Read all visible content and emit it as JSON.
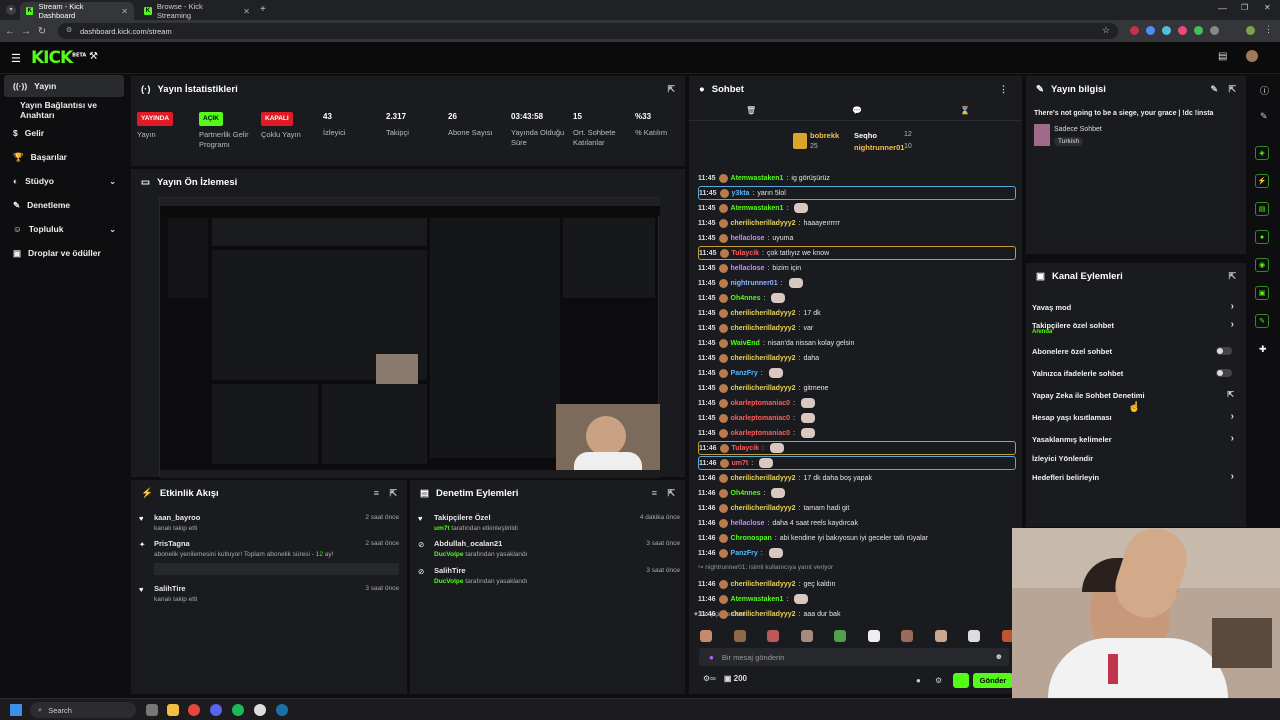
{
  "browser": {
    "tabs": [
      {
        "title": "Stream - Kick Dashboard"
      },
      {
        "title": "Browse - Kick Streaming"
      }
    ],
    "url": "dashboard.kick.com/stream"
  },
  "header": {
    "logo": "KICK",
    "logo_sup": "BETA"
  },
  "sidebar": {
    "items": [
      {
        "label": "Yayın",
        "icon": "broadcast-icon"
      },
      {
        "label": "Yayın Bağlantısı ve Anahtarı",
        "icon": ""
      },
      {
        "label": "Gelir",
        "icon": "dollar-icon"
      },
      {
        "label": "Başarılar",
        "icon": "trophy-icon"
      },
      {
        "label": "Stüdyo",
        "icon": "palette-icon"
      },
      {
        "label": "Denetleme",
        "icon": "wrench-icon"
      },
      {
        "label": "Topluluk",
        "icon": "people-icon"
      },
      {
        "label": "Droplar ve ödüller",
        "icon": "gift-icon"
      }
    ]
  },
  "stats": {
    "title": "Yayın İstatistikleri",
    "items": [
      {
        "badge": "YAYINDA",
        "label": "Yayın"
      },
      {
        "badge": "AÇIK",
        "label": "Partnerlik Gelir Programı"
      },
      {
        "badge": "KAPALI",
        "label": "Çoklu Yayın"
      },
      {
        "value": "43",
        "label": "İzleyici"
      },
      {
        "value": "2.317",
        "label": "Takipçi"
      },
      {
        "value": "26",
        "label": "Abone Sayısı"
      },
      {
        "value": "03:43:58",
        "label": "Yayında Olduğu Süre"
      },
      {
        "value": "15",
        "label": "Ort. Sohbete Katılanlar"
      },
      {
        "value": "%33",
        "label": "% Katılım"
      }
    ]
  },
  "preview": {
    "title": "Yayın Ön İzlemesi"
  },
  "activity": {
    "title": "Etkinlik Akışı",
    "items": [
      {
        "name": "kaan_bayroo",
        "desc": "kanalı takip etti",
        "time": "2 saat önce"
      },
      {
        "name": "PrisTagna",
        "desc": "abonelik yenilemesini kutluyor! Toplam abonelik süresi - ",
        "months": "12",
        "desc2": " ay!",
        "time": "2 saat önce"
      },
      {
        "name": "SalihTire",
        "desc": "kanalı takip etti",
        "time": "3 saat önce"
      }
    ]
  },
  "modactions": {
    "title": "Denetim Eylemleri",
    "items": [
      {
        "title": "Takipçilere Özel",
        "actor": "um7t",
        "desc": " tarafından etkinleştirildi",
        "time": "4 dakika önce"
      },
      {
        "title": "Abdullah_ocalan21",
        "actor": "DucVolpe",
        "desc": " tarafından yasaklandı",
        "time": "3 saat önce"
      },
      {
        "title": "SalihTire",
        "actor": "DucVolpe",
        "desc": " tarafından yasaklandı",
        "time": "3 saat önce"
      }
    ]
  },
  "chat": {
    "title": "Sohbet",
    "leaderboard": [
      {
        "name": "bobrekk",
        "count": "25"
      },
      {
        "name": "Seqho",
        "count": "12"
      },
      {
        "name": "nightrunner01",
        "count": "10"
      }
    ],
    "messages": [
      {
        "time": "11:45",
        "user": "Atemwastaken1",
        "color": "#53fc18",
        "text": "ig görüşürüz"
      },
      {
        "time": "11:45",
        "user": "y3kta",
        "color": "#57b7ff",
        "text": "yarın 5lol",
        "hl": "blue"
      },
      {
        "time": "11:45",
        "user": "Atemwastaken1",
        "color": "#53fc18",
        "text": ""
      },
      {
        "time": "11:45",
        "user": "cherilicherilladyyy2",
        "color": "#e6d25a",
        "text": "haaayeırrrrr"
      },
      {
        "time": "11:45",
        "user": "hellaclose",
        "color": "#c48cff",
        "text": "uyuma"
      },
      {
        "time": "11:45",
        "user": "Tulaycik",
        "color": "#ff5b5b",
        "text": "çok tatlıyız we know",
        "hl": "gold"
      },
      {
        "time": "11:45",
        "user": "hellaclose",
        "color": "#c48cff",
        "text": "bizim için"
      },
      {
        "time": "11:45",
        "user": "nightrunner01",
        "color": "#8fb4ff",
        "text": ""
      },
      {
        "time": "11:45",
        "user": "Oh4nnes",
        "color": "#53fc18",
        "text": ""
      },
      {
        "time": "11:45",
        "user": "cherilicherilladyyy2",
        "color": "#e6d25a",
        "text": "17 dk"
      },
      {
        "time": "11:45",
        "user": "cherilicherilladyyy2",
        "color": "#e6d25a",
        "text": "var"
      },
      {
        "time": "11:45",
        "user": "WaivEnd",
        "color": "#53fc18",
        "text": "nisan'da nissan kolay gelsin"
      },
      {
        "time": "11:45",
        "user": "cherilicherilladyyy2",
        "color": "#e6d25a",
        "text": "daha"
      },
      {
        "time": "11:45",
        "user": "PanzFry",
        "color": "#57b7ff",
        "text": ""
      },
      {
        "time": "11:45",
        "user": "cherilicherilladyyy2",
        "color": "#e6d25a",
        "text": "gitmene"
      },
      {
        "time": "11:45",
        "user": "okarleptomaniac0",
        "color": "#ff5b5b",
        "text": ""
      },
      {
        "time": "11:45",
        "user": "okarleptomaniac0",
        "color": "#ff5b5b",
        "text": ""
      },
      {
        "time": "11:45",
        "user": "okarleptomaniac0",
        "color": "#ff5b5b",
        "text": ""
      },
      {
        "time": "11:46",
        "user": "Tulaycik",
        "color": "#ff5b5b",
        "text": "",
        "hl": "gold"
      },
      {
        "time": "11:46",
        "user": "um7t",
        "color": "#ff5b5b",
        "text": "",
        "hl": "blue"
      },
      {
        "time": "11:46",
        "user": "cherilicherilladyyy2",
        "color": "#e6d25a",
        "text": "17 dk daha boş yapak"
      },
      {
        "time": "11:46",
        "user": "Oh4nnes",
        "color": "#53fc18",
        "text": ""
      },
      {
        "time": "11:46",
        "user": "cherilicherilladyyy2",
        "color": "#e6d25a",
        "text": "tamam hadi git"
      },
      {
        "time": "11:46",
        "user": "hellaclose",
        "color": "#c48cff",
        "text": "daha 4 saat reels kaydırcak"
      },
      {
        "time": "11:46",
        "user": "Chronospan",
        "color": "#53fc18",
        "text": "abi kendine iyi bakıyosun iyi geceler tatlı rüyalar"
      },
      {
        "time": "11:46",
        "user": "PanzFry",
        "color": "#57b7ff",
        "text": ""
      },
      {
        "time": "11:46",
        "user": "cherilicherilladyyy2",
        "color": "#e6d25a",
        "text": "geç kaldın"
      },
      {
        "time": "11:46",
        "user": "Atemwastaken1",
        "color": "#53fc18",
        "text": ""
      },
      {
        "time": "11:46",
        "user": "cherilicherilladyyy2",
        "color": "#e6d25a",
        "text": "aaa dur bak"
      }
    ],
    "reply_note": "nightrunner01:",
    "reply_note2": "isimli kullanıcıya yanıt veriyor",
    "followers_only": "Takipçilere Özel",
    "input_placeholder": "Bir mesaj gönderin",
    "points": "200",
    "send_label": "Gönder"
  },
  "streaminfo": {
    "title": "Yayın bilgisi",
    "stream_title": "There's not going to be a siege, your grace | !dc !insta",
    "category": "Sadece Sohbet",
    "language": "Turkish"
  },
  "channelactions": {
    "title": "Kanal Eylemleri",
    "items": [
      {
        "label": "Yavaş mod",
        "control": "chevron"
      },
      {
        "label": "Takipçilere özel sohbet",
        "sub": "Anında",
        "control": "chevron"
      },
      {
        "label": "Abonelere özel sohbet",
        "control": "toggle"
      },
      {
        "label": "Yalnızca ifadelerle sohbet",
        "control": "toggle"
      },
      {
        "label": "Yapay Zeka ile Sohbet Denetimi",
        "control": "external"
      },
      {
        "label": "Hesap yaşı kısıtlaması",
        "control": "chevron"
      },
      {
        "label": "Yasaklanmış kelimeler",
        "control": "chevron"
      },
      {
        "label": "İzleyici Yönlendir",
        "control": "none"
      },
      {
        "label": "Hedefleri belirleyin",
        "control": "chevron"
      }
    ]
  },
  "taskbar": {
    "search": "Search"
  },
  "colors": {
    "brand": "#53fc18",
    "live": "#e01b24",
    "panel": "#191b1f"
  }
}
